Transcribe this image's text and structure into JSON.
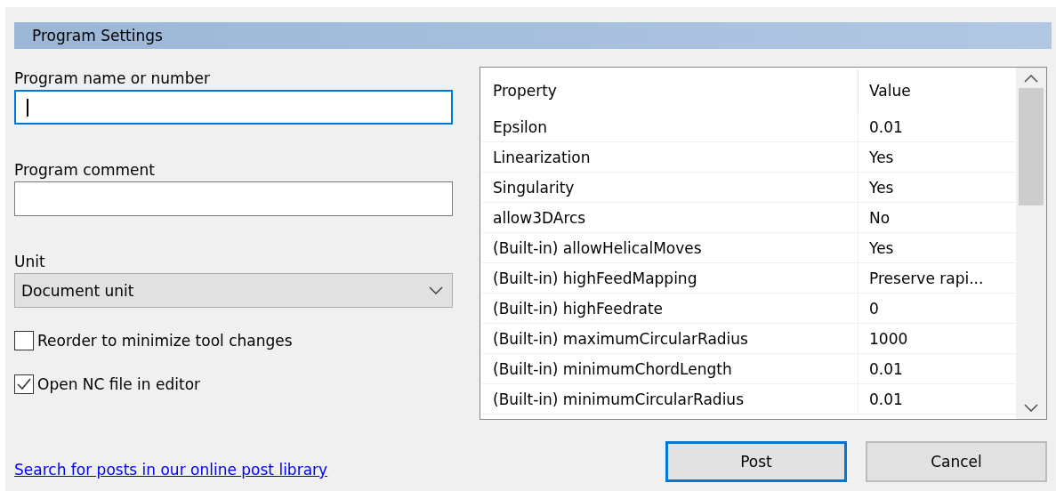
{
  "section": {
    "title": "Program Settings"
  },
  "fields": [
    {
      "label": "Program name or number",
      "focused": true
    },
    {
      "label": "Program comment",
      "focused": false
    }
  ],
  "unit": {
    "label": "Unit",
    "value": "Document unit"
  },
  "checkboxes": [
    {
      "label": "Reorder to minimize tool changes",
      "checked": false
    },
    {
      "label": "Open NC file in editor",
      "checked": true
    }
  ],
  "link": "Search for posts in our online post library",
  "table": {
    "columns": [
      "Property",
      "Value"
    ],
    "rows": [
      [
        "Epsilon",
        "0.01"
      ],
      [
        "Linearization",
        "Yes"
      ],
      [
        "Singularity",
        "Yes"
      ],
      [
        "allow3DArcs",
        "No"
      ],
      [
        "(Built-in) allowHelicalMoves",
        "Yes"
      ],
      [
        "(Built-in) highFeedMapping",
        "Preserve rapi..."
      ],
      [
        "(Built-in) highFeedrate",
        "0"
      ],
      [
        "(Built-in) maximumCircularRadius",
        "1000"
      ],
      [
        "(Built-in) minimumChordLength",
        "0.01"
      ],
      [
        "(Built-in) minimumCircularRadius",
        "0.01"
      ]
    ]
  },
  "buttons": [
    {
      "label": "Post",
      "default": true
    },
    {
      "label": "Cancel",
      "default": false
    }
  ]
}
